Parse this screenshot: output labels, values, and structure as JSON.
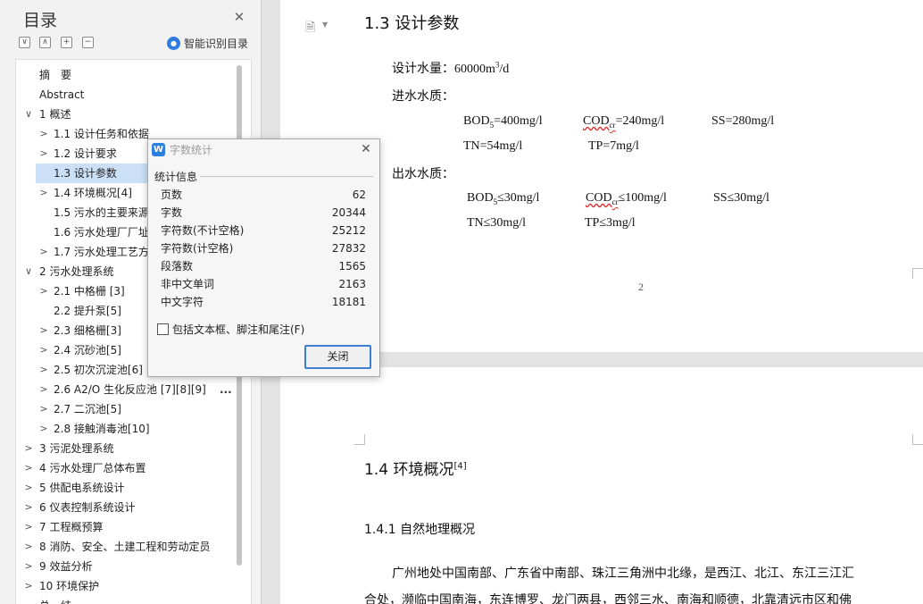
{
  "toc": {
    "title": "目录",
    "smart_label": "智能识别目录",
    "more": "...",
    "items": [
      {
        "label": "摘　要",
        "arrow": "",
        "indent": 0
      },
      {
        "label": "Abstract",
        "arrow": "",
        "indent": 0
      },
      {
        "label": "1  概述",
        "arrow": "∨",
        "indent": 0
      },
      {
        "label": "1.1  设计任务和依据",
        "arrow": ">",
        "indent": 1
      },
      {
        "label": "1.2  设计要求",
        "arrow": ">",
        "indent": 1
      },
      {
        "label": "1.3  设计参数",
        "arrow": "",
        "indent": 1,
        "selected": true
      },
      {
        "label": "1.4  环境概况[4]",
        "arrow": ">",
        "indent": 1
      },
      {
        "label": "1.5  污水的主要来源",
        "arrow": "",
        "indent": 1
      },
      {
        "label": "1.6  污水处理厂厂址",
        "arrow": "",
        "indent": 1
      },
      {
        "label": "1.7  污水处理工艺方",
        "arrow": ">",
        "indent": 1
      },
      {
        "label": "2  污水处理系统",
        "arrow": "∨",
        "indent": 0
      },
      {
        "label": "2.1  中格栅  [3]",
        "arrow": ">",
        "indent": 1
      },
      {
        "label": "2.2  提升泵[5]",
        "arrow": "",
        "indent": 1
      },
      {
        "label": "2.3  细格栅[3]",
        "arrow": ">",
        "indent": 1
      },
      {
        "label": "2.4  沉砂池[5]",
        "arrow": ">",
        "indent": 1
      },
      {
        "label": "2.5  初次沉淀池[6]",
        "arrow": ">",
        "indent": 1
      },
      {
        "label": "2.6 A2/O 生化反应池  [7][8][9]",
        "arrow": ">",
        "indent": 1,
        "more": true
      },
      {
        "label": "2.7  二沉池[5]",
        "arrow": ">",
        "indent": 1
      },
      {
        "label": "2.8  接触消毒池[10]",
        "arrow": ">",
        "indent": 1
      },
      {
        "label": "3  污泥处理系统",
        "arrow": ">",
        "indent": 0
      },
      {
        "label": "4  污水处理厂总体布置",
        "arrow": ">",
        "indent": 0
      },
      {
        "label": "5  供配电系统设计",
        "arrow": ">",
        "indent": 0
      },
      {
        "label": "6  仪表控制系统设计",
        "arrow": ">",
        "indent": 0
      },
      {
        "label": "7  工程概预算",
        "arrow": ">",
        "indent": 0
      },
      {
        "label": "8  消防、安全、土建工程和劳动定员",
        "arrow": ">",
        "indent": 0
      },
      {
        "label": "9  效益分析",
        "arrow": ">",
        "indent": 0
      },
      {
        "label": "10  环境保护",
        "arrow": ">",
        "indent": 0
      },
      {
        "label": "总　结",
        "arrow": "",
        "indent": 0
      }
    ]
  },
  "doc": {
    "page1": {
      "heading": "1.3  设计参数",
      "water_label": "设计水量：",
      "water_value": "60000m",
      "water_sup": "3",
      "water_unit": "/d",
      "inflow_label": "进水水质：",
      "in_bod": "BOD",
      "in_bod_sub": "5",
      "in_bod_val": "=400mg/l",
      "in_cod": "COD",
      "in_cod_sub": "cr",
      "in_cod_val": "=240mg/l",
      "in_ss": "SS=280mg/l",
      "in_tn": "TN=54mg/l",
      "in_tp": "TP=7mg/l",
      "outflow_label": "出水水质：",
      "out_bod": "BOD",
      "out_bod_sub": "5",
      "out_bod_val": "≤30mg/l",
      "out_cod": "COD",
      "out_cod_sub": "cr",
      "out_cod_val": "≤100mg/l",
      "out_ss": "SS≤30mg/l",
      "out_tn": "TN≤30mg/l",
      "out_tp": "TP≤3mg/l",
      "page_number": "2"
    },
    "page2": {
      "heading": "1.4  环境概况",
      "heading_sup": "[4]",
      "subheading": "1.4.1  自然地理概况",
      "para_line1": "广州地处中国南部、广东省中南部、珠江三角洲中北缘，是西江、北江、东江三江汇",
      "para_line2": "合处，濒临中国南海，东连博罗、龙门两县，西邻三水、南海和顺德，北靠清远市区和佛"
    }
  },
  "dialog": {
    "title": "字数统计",
    "group_label": "统计信息",
    "stats": [
      {
        "label": "页数",
        "value": "62"
      },
      {
        "label": "字数",
        "value": "20344"
      },
      {
        "label": "字符数(不计空格)",
        "value": "25212"
      },
      {
        "label": "字符数(计空格)",
        "value": "27832"
      },
      {
        "label": "段落数",
        "value": "1565"
      },
      {
        "label": "非中文单词",
        "value": "2163"
      },
      {
        "label": "中文字符",
        "value": "18181"
      }
    ],
    "checkbox_label": "包括文本框、脚注和尾注(F)",
    "close_button": "关闭"
  }
}
